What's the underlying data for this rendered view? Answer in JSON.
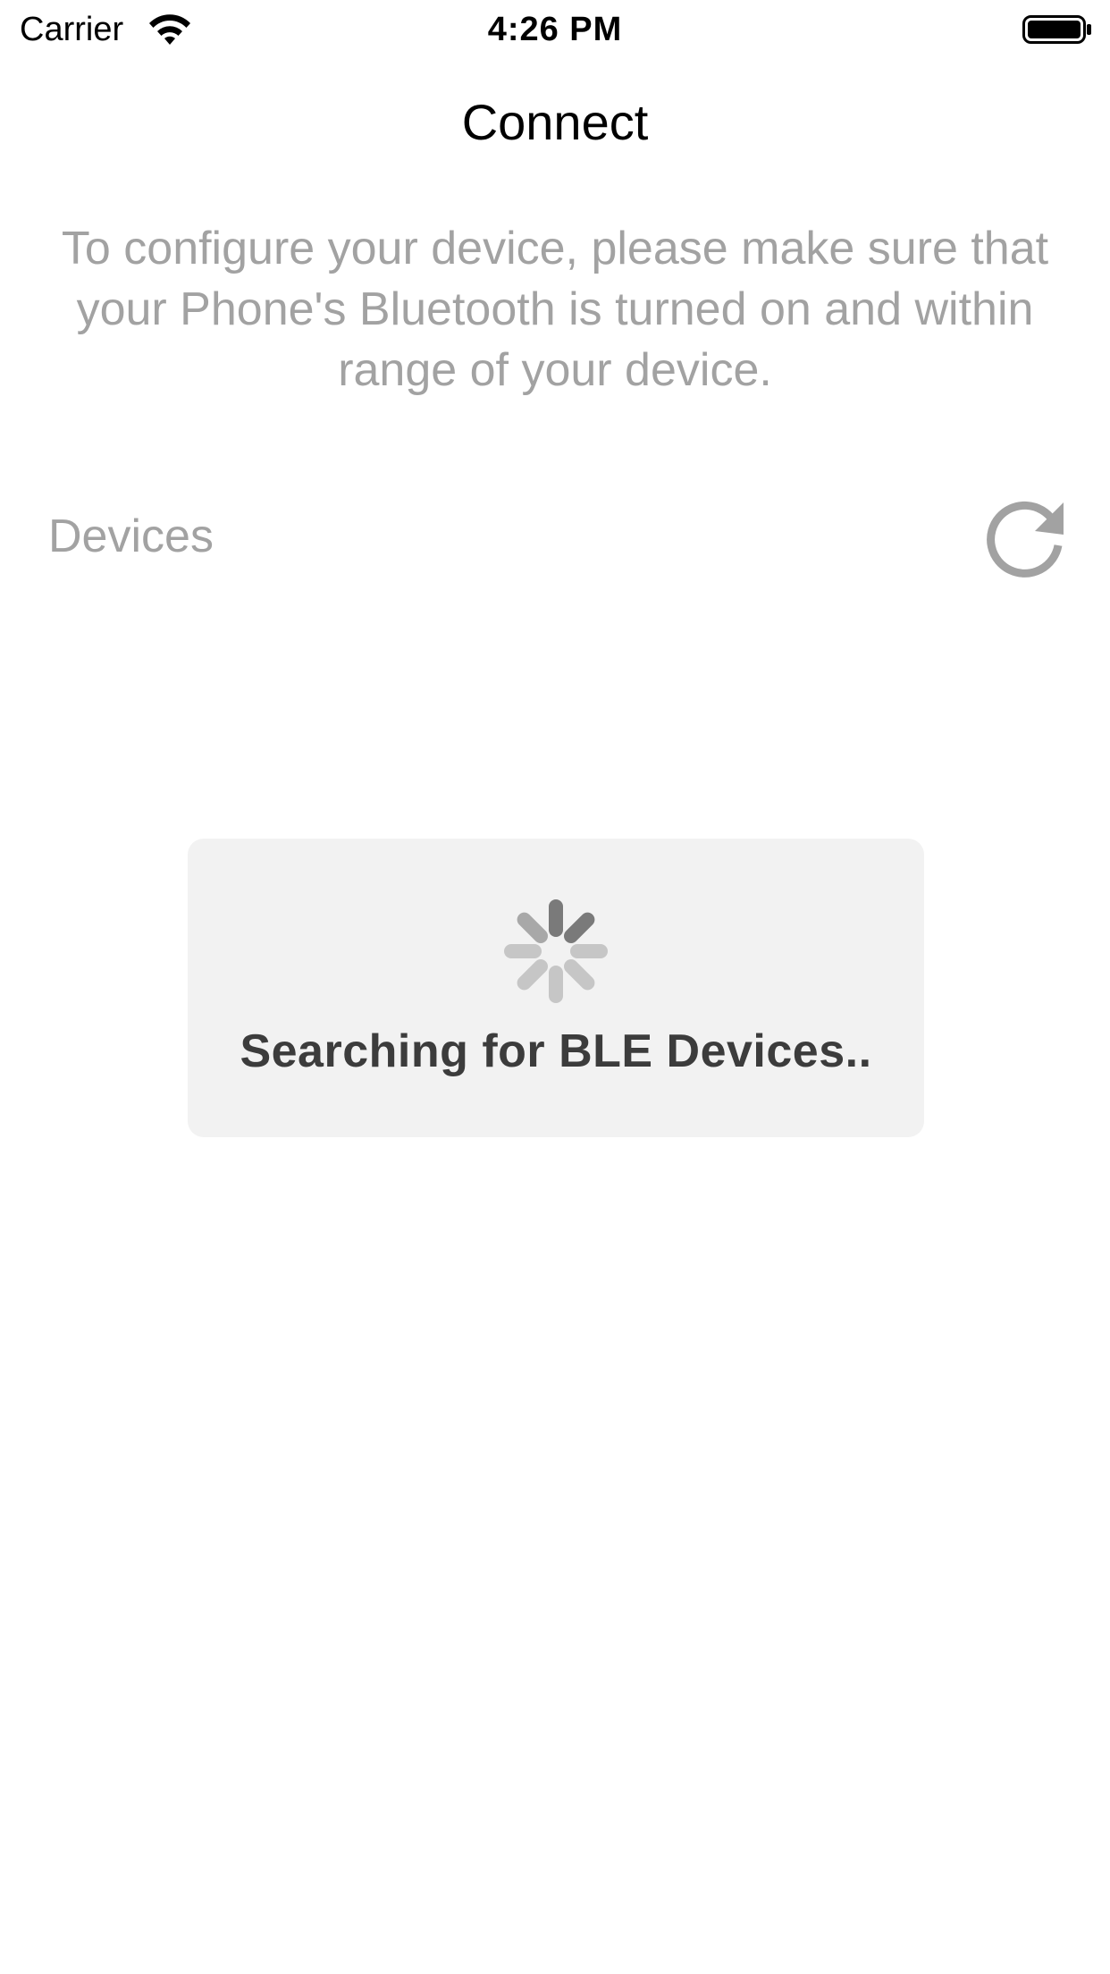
{
  "status_bar": {
    "carrier": "Carrier",
    "time": "4:26 PM",
    "wifi_icon": "wifi-icon",
    "battery_icon": "battery-icon"
  },
  "header": {
    "title": "Connect"
  },
  "instructions": {
    "text": "To configure your device, please make sure that your Phone's Bluetooth is turned on and within range of your device."
  },
  "devices": {
    "label": "Devices",
    "refresh_icon": "refresh-icon"
  },
  "loading": {
    "spinner_icon": "activity-spinner-icon",
    "message": "Searching for BLE Devices.."
  }
}
